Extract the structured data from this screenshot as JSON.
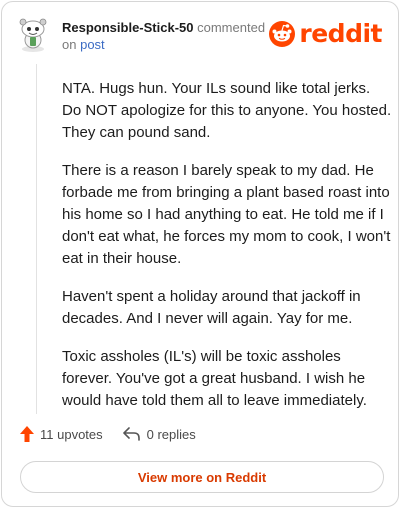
{
  "header": {
    "author": "Responsible-Stick-50",
    "action_text": "commented",
    "on_text": "on",
    "post_link": "post",
    "brand": "reddit"
  },
  "comment": {
    "paragraphs": [
      "NTA. Hugs hun. Your ILs sound like total jerks. Do NOT apologize for this to anyone. You hosted. They can pound sand.",
      "There is a reason I barely speak to my dad. He forbade me from bringing a plant based roast into his home so I had anything to eat. He told me if I don't eat what, he forces my mom to cook, I won't eat in their house.",
      "Haven't spent a holiday around that jackoff in decades. And I never will again. Yay for me.",
      "Toxic assholes (IL's) will be toxic assholes forever. You've got a great husband. I wish he would have told them all to leave immediately."
    ]
  },
  "actions": {
    "upvotes": "11 upvotes",
    "replies": "0 replies"
  },
  "footer": {
    "more_label": "View more on Reddit"
  },
  "colors": {
    "brand": "#ff4500",
    "more_text": "#d93a00",
    "link": "#3c6cc4"
  },
  "icons": [
    "avatar",
    "reddit-snoo-icon",
    "upvote-arrow-icon",
    "reply-icon"
  ]
}
